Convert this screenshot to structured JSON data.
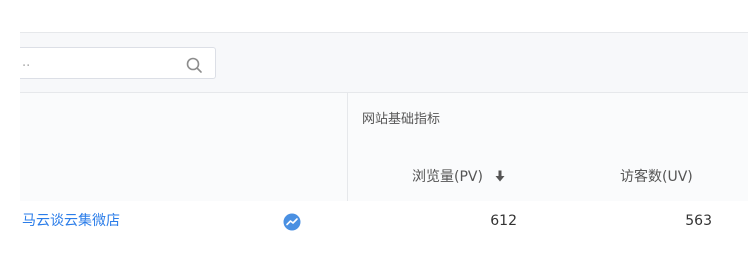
{
  "search": {
    "placeholder": ".."
  },
  "table": {
    "group_header": "网站基础指标",
    "columns": [
      {
        "label": "浏览量(PV)",
        "sorted": "descending"
      },
      {
        "label": "访客数(UV)"
      }
    ],
    "rows": [
      {
        "name": "马云谈云集微店",
        "pv": "612",
        "uv": "563"
      }
    ]
  },
  "colors": {
    "link": "#2b7de9",
    "header_bg": "#fafbfc",
    "border": "#e6e8eb"
  },
  "icons": {
    "search": "search-icon",
    "sort": "arrow-down-icon",
    "trend": "trend-chart-icon"
  }
}
